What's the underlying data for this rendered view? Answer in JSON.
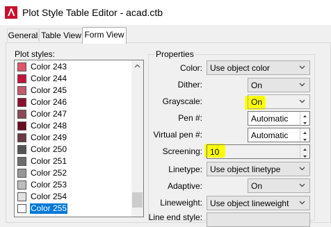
{
  "window": {
    "title": "Plot Style Table Editor - acad.ctb"
  },
  "tabs": [
    {
      "label": "General"
    },
    {
      "label": "Table View"
    },
    {
      "label": "Form View"
    }
  ],
  "plot_styles": {
    "label": "Plot styles:",
    "items": [
      {
        "label": "Color 243",
        "color": "#e0566c"
      },
      {
        "label": "Color 244",
        "color": "#c0143a"
      },
      {
        "label": "Color 245",
        "color": "#c25a6c"
      },
      {
        "label": "Color 246",
        "color": "#8e1030"
      },
      {
        "label": "Color 247",
        "color": "#8c4a58"
      },
      {
        "label": "Color 248",
        "color": "#6a0c22"
      },
      {
        "label": "Color 249",
        "color": "#6a3a44"
      },
      {
        "label": "Color 250",
        "color": "#555555"
      },
      {
        "label": "Color 251",
        "color": "#6e6e6e"
      },
      {
        "label": "Color 252",
        "color": "#979797"
      },
      {
        "label": "Color 253",
        "color": "#bdbdbd"
      },
      {
        "label": "Color 254",
        "color": "#e2e2e2"
      },
      {
        "label": "Color 255",
        "color": "#ffffff"
      }
    ],
    "selected_index": 12
  },
  "properties": {
    "label": "Properties",
    "color": {
      "label": "Color:",
      "value": "Use object color"
    },
    "dither": {
      "label": "Dither:",
      "value": "On"
    },
    "grayscale": {
      "label": "Grayscale:",
      "value": "On"
    },
    "pen": {
      "label": "Pen #:",
      "value": "Automatic"
    },
    "virtual_pen": {
      "label": "Virtual pen #:",
      "value": "Automatic"
    },
    "screening": {
      "label": "Screening:",
      "value": "10"
    },
    "linetype": {
      "label": "Linetype:",
      "value": "Use object linetype"
    },
    "adaptive": {
      "label": "Adaptive:",
      "value": "On"
    },
    "lineweight": {
      "label": "Lineweight:",
      "value": "Use object lineweight"
    },
    "line_end_style": {
      "label": "Line end style:"
    }
  },
  "highlight_color": "#ffff00",
  "selection_color": "#0078d7"
}
